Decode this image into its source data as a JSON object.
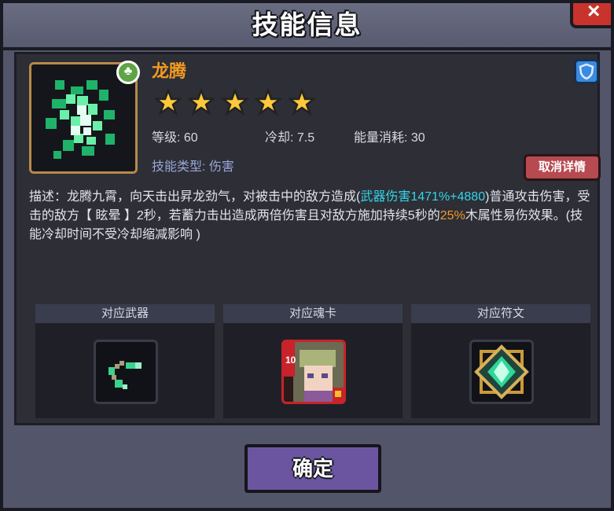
{
  "window": {
    "title": "技能信息",
    "close_glyph": "×"
  },
  "skill": {
    "name": "龙腾",
    "element_badge": "♣",
    "stars": 5,
    "level_label": "等级: 60",
    "cooldown_label": "冷却: 7.5",
    "energy_label": "能量消耗: 30",
    "type_label": "技能类型: 伤害",
    "cancel_details": "取消详情",
    "description": {
      "part1": "描述：龙腾九霄，向天击出昇龙劲气，对被击中的敌方造成(",
      "weapon_damage": "武器伤害1471%+4880",
      "part2": ")普通攻击伤害，受击的敌方【 眩晕 】2秒，若蓄力击出造成两倍伤害且对敌方施加持续5秒的",
      "percent": "25%",
      "part3": "木属性易伤效果。(技能冷却时间不受冷却缩减影响 )"
    }
  },
  "cards": [
    {
      "title": "对应武器",
      "icon": "nunchaku-icon"
    },
    {
      "title": "对应魂卡",
      "icon": "soul-card-icon",
      "card_level": "10"
    },
    {
      "title": "对应符文",
      "icon": "rune-icon"
    }
  ],
  "confirm_label": "确定",
  "colors": {
    "accent_orange": "#f39a1f",
    "accent_cyan": "#33d6e8",
    "confirm_button": "#6c55a0",
    "cancel_button": "#b64a50"
  }
}
